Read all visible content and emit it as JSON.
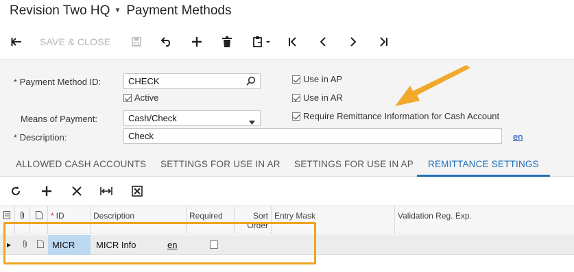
{
  "header": {
    "company": "Revision Two HQ",
    "screen_title": "Payment Methods",
    "company_menu_icon": "caret-down-icon"
  },
  "toolbar": {
    "back_icon": "back-arrow-icon",
    "save_close_label": "SAVE & CLOSE",
    "save_icon": "save-icon",
    "undo_icon": "undo-icon",
    "add_icon": "plus-icon",
    "delete_icon": "trash-icon",
    "clipboard_icon": "clipboard-icon",
    "first_icon": "first-record-icon",
    "prev_icon": "previous-icon",
    "next_icon": "next-icon",
    "last_icon": "last-record-icon"
  },
  "form": {
    "payment_method_id_label": "Payment Method ID:",
    "payment_method_id_value": "CHECK",
    "active_label": "Active",
    "active_checked": true,
    "means_label": "Means of Payment:",
    "means_value": "Cash/Check",
    "description_label": "Description:",
    "description_value": "Check",
    "language_link": "en",
    "use_in_ap_label": "Use in AP",
    "use_in_ap_checked": true,
    "use_in_ar_label": "Use in AR",
    "use_in_ar_checked": true,
    "require_remittance_label": "Require Remittance Information for Cash Account",
    "require_remittance_checked": true,
    "required_marker": "*"
  },
  "tabs": [
    {
      "label": "ALLOWED CASH ACCOUNTS",
      "active": false
    },
    {
      "label": "SETTINGS FOR USE IN AR",
      "active": false
    },
    {
      "label": "SETTINGS FOR USE IN AP",
      "active": false
    },
    {
      "label": "REMITTANCE SETTINGS",
      "active": true
    }
  ],
  "grid": {
    "toolbar_icons": [
      "refresh-icon",
      "plus-icon",
      "close-icon",
      "fit-columns-icon",
      "export-excel-icon"
    ],
    "headers": {
      "id": "ID",
      "description": "Description",
      "required": "Required",
      "sort_order": "Sort Order",
      "entry_mask": "Entry Mask",
      "validation": "Validation Reg. Exp."
    },
    "rows": [
      {
        "id": "MICR",
        "description": "MICR Info",
        "lang": "en",
        "required": false
      }
    ]
  },
  "colors": {
    "accent": "#1f6fb8",
    "highlight": "#f0a320",
    "selected_cell": "#bcd9f1"
  }
}
